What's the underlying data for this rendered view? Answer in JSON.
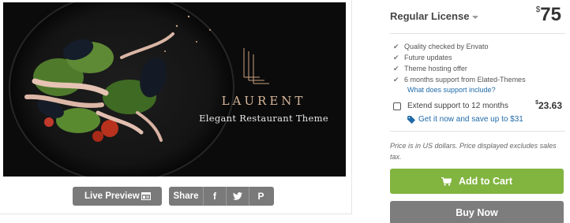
{
  "preview": {
    "brand": "LAURENT",
    "tagline": "Elegant Restaurant Theme",
    "live_preview_label": "Live Preview",
    "live_preview_icon": "preview-window-icon",
    "share_label": "Share",
    "share_icons": [
      "facebook-icon",
      "twitter-icon",
      "pinterest-icon"
    ],
    "share_glyphs": {
      "facebook": "f",
      "pinterest": "P"
    }
  },
  "license": {
    "title": "Regular License",
    "currency": "$",
    "price": "75"
  },
  "features": [
    "Quality checked by Envato",
    "Future updates",
    "Theme hosting offer",
    "6 months support from Elated-Themes"
  ],
  "support_link": "What does support include?",
  "extend": {
    "label": "Extend support to 12 months",
    "currency": "$",
    "price": "23.63",
    "save_text": "Get it now and save up to $31"
  },
  "note": "Price is in US dollars. Price displayed excludes sales tax.",
  "buttons": {
    "add_to_cart": "Add to Cart",
    "buy_now": "Buy Now"
  },
  "colors": {
    "cart_green": "#82b440",
    "buy_gray": "#7d7d7d",
    "link_blue": "#1f6aa8",
    "brand_gold": "#d7b79a"
  }
}
